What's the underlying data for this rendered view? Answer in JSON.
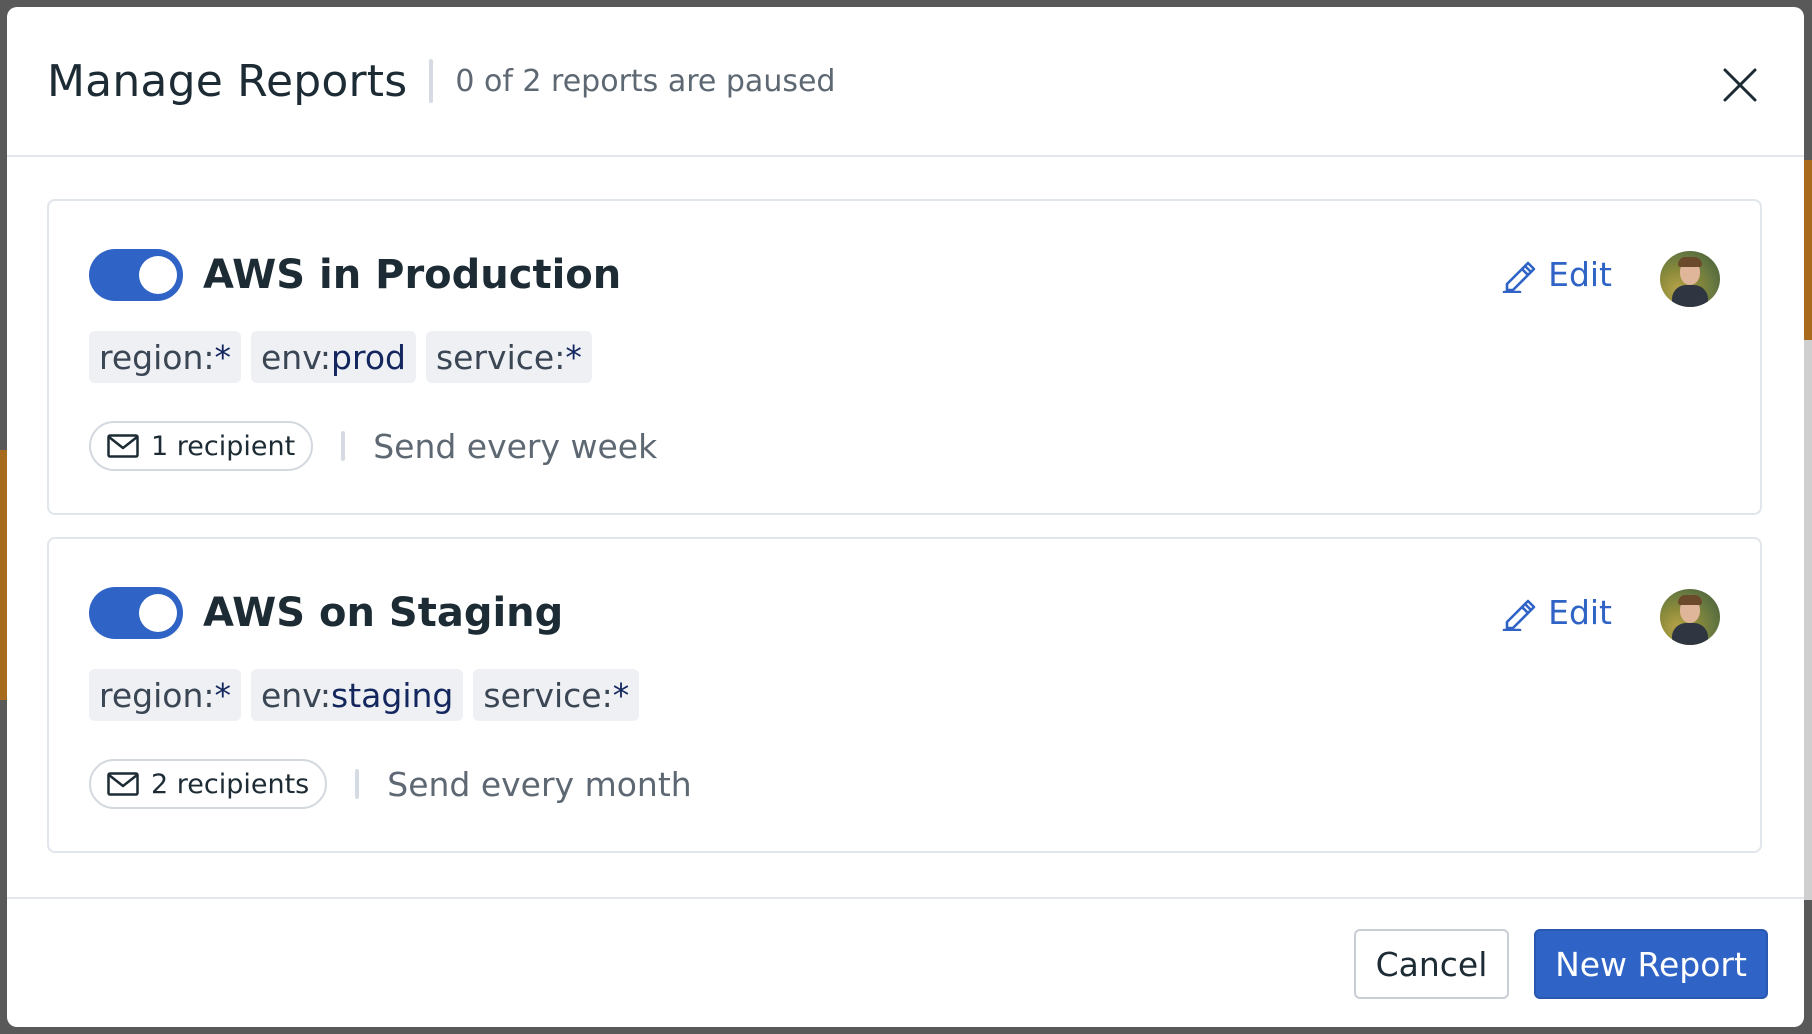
{
  "modal": {
    "title": "Manage Reports",
    "subtitle": "0 of 2 reports are paused",
    "close_icon": "close-icon"
  },
  "reports": [
    {
      "name": "AWS in Production",
      "enabled": true,
      "tags": [
        {
          "key": "region:",
          "value": "*"
        },
        {
          "key": "env:",
          "value": "prod"
        },
        {
          "key": "service:",
          "value": "*"
        }
      ],
      "recipients": "1 recipient",
      "schedule": "Send every week",
      "edit_label": "Edit"
    },
    {
      "name": "AWS on Staging",
      "enabled": true,
      "tags": [
        {
          "key": "region:",
          "value": "*"
        },
        {
          "key": "env:",
          "value": "staging"
        },
        {
          "key": "service:",
          "value": "*"
        }
      ],
      "recipients": "2 recipients",
      "schedule": "Send every month",
      "edit_label": "Edit"
    }
  ],
  "footer": {
    "cancel_label": "Cancel",
    "primary_label": "New Report"
  },
  "colors": {
    "accent": "#2f63c5",
    "tag_bg": "#eef0f4",
    "muted_text": "#5d6873"
  }
}
